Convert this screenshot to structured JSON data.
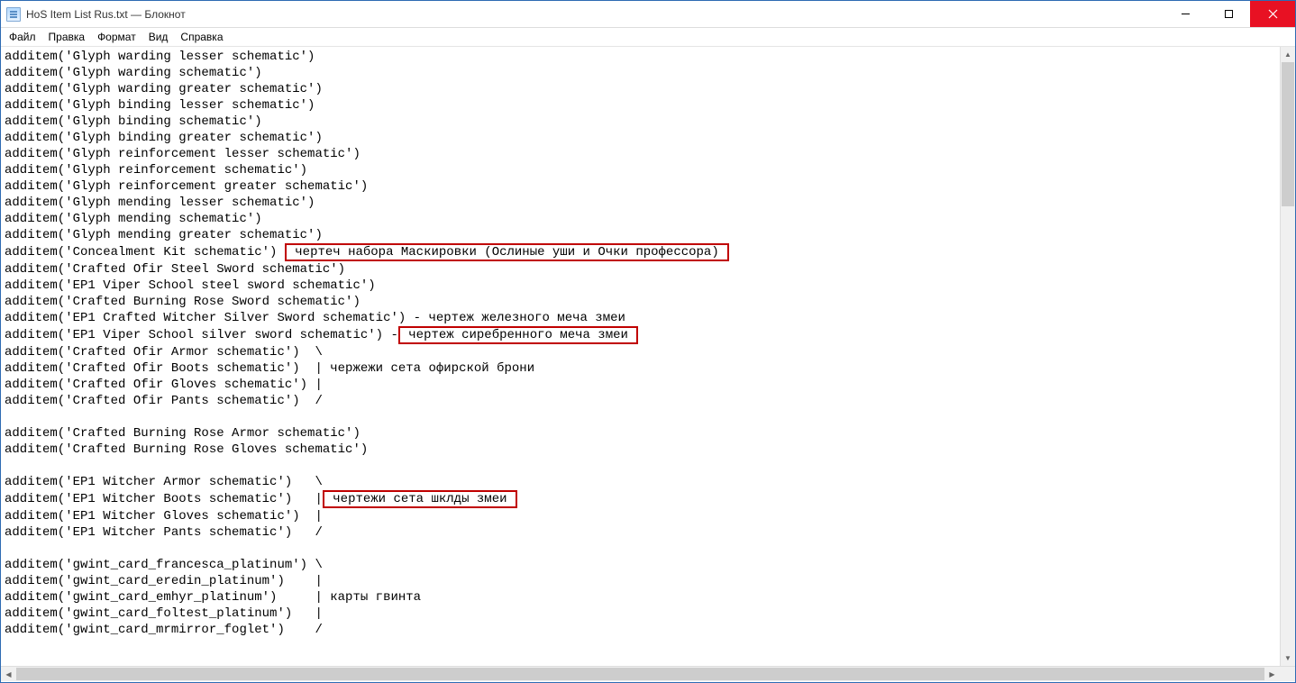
{
  "title": "HoS Item List Rus.txt — Блокнот",
  "menu": {
    "file": "Файл",
    "edit": "Правка",
    "format": "Формат",
    "view": "Вид",
    "help": "Справка"
  },
  "lines": {
    "l0": "additem('Glyph warding lesser schematic')",
    "l1": "additem('Glyph warding schematic')",
    "l2": "additem('Glyph warding greater schematic')",
    "l3": "additem('Glyph binding lesser schematic')",
    "l4": "additem('Glyph binding schematic')",
    "l5": "additem('Glyph binding greater schematic')",
    "l6": "additem('Glyph reinforcement lesser schematic')",
    "l7": "additem('Glyph reinforcement schematic')",
    "l8": "additem('Glyph reinforcement greater schematic')",
    "l9": "additem('Glyph mending lesser schematic')",
    "l10": "additem('Glyph mending schematic')",
    "l11": "additem('Glyph mending greater schematic')",
    "l12a": "additem('Concealment Kit schematic') ",
    "l12b": " чертеч набора Маскировки (Ослиные уши и Очки профессора) ",
    "l13": "additem('Crafted Ofir Steel Sword schematic')",
    "l14": "additem('EP1 Viper School steel sword schematic')",
    "l15": "additem('Crafted Burning Rose Sword schematic')",
    "l16": "additem('EP1 Crafted Witcher Silver Sword schematic') - чертеж железного меча змеи",
    "l17a": "additem('EP1 Viper School silver sword schematic') -",
    "l17b": " чертеж сиребренного меча змеи ",
    "l18": "additem('Crafted Ofir Armor schematic')  \\",
    "l19": "additem('Crafted Ofir Boots schematic')  | чержежи сета офирской брони",
    "l20": "additem('Crafted Ofir Gloves schematic') |",
    "l21": "additem('Crafted Ofir Pants schematic')  /",
    "l22": "",
    "l23": "additem('Crafted Burning Rose Armor schematic')",
    "l24": "additem('Crafted Burning Rose Gloves schematic')",
    "l25": "",
    "l26": "additem('EP1 Witcher Armor schematic')   \\",
    "l27a": "additem('EP1 Witcher Boots schematic')   |",
    "l27b": " чертежи сета шклды змеи ",
    "l28": "additem('EP1 Witcher Gloves schematic')  |",
    "l29": "additem('EP1 Witcher Pants schematic')   /",
    "l30": "",
    "l31": "additem('gwint_card_francesca_platinum') \\",
    "l32": "additem('gwint_card_eredin_platinum')    |",
    "l33": "additem('gwint_card_emhyr_platinum')     | карты гвинта",
    "l34": "additem('gwint_card_foltest_platinum')   |",
    "l35": "additem('gwint_card_mrmirror_foglet')    /"
  }
}
